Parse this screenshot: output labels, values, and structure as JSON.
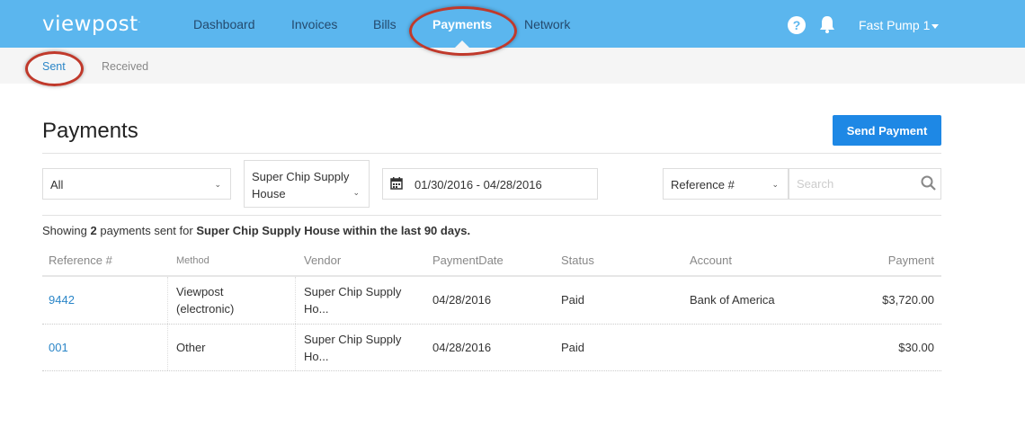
{
  "brand": {
    "logo": "viewpost",
    "mark": "."
  },
  "nav": {
    "items": [
      {
        "label": "Dashboard"
      },
      {
        "label": "Invoices"
      },
      {
        "label": "Bills"
      },
      {
        "label": "Payments",
        "active": true
      },
      {
        "label": "Network"
      }
    ],
    "user": "Fast Pump 1",
    "help_glyph": "?"
  },
  "subnav": {
    "items": [
      {
        "label": "Sent",
        "active": true
      },
      {
        "label": "Received"
      }
    ]
  },
  "page": {
    "title": "Payments",
    "send_button": "Send Payment"
  },
  "filters": {
    "status": "All",
    "vendor_line1": "Super Chip Supply",
    "vendor_line2": "House",
    "date_range": "01/30/2016 - 04/28/2016",
    "search_field": "Reference #",
    "search_placeholder": "Search"
  },
  "summary": {
    "prefix": "Showing",
    "count": "2",
    "middle": "payments sent for",
    "vendor": "Super Chip Supply House within the last 90 days."
  },
  "table": {
    "columns": [
      "Reference #",
      "Method",
      "Vendor",
      "PaymentDate",
      "Status",
      "Account",
      "Payment"
    ],
    "rows": [
      {
        "reference": "9442",
        "method_l1": "Viewpost",
        "method_l2": "(electronic)",
        "vendor_l1": "Super Chip Supply",
        "vendor_l2": "Ho...",
        "date": "04/28/2016",
        "status": "Paid",
        "account": "Bank of America",
        "payment": "$3,720.00"
      },
      {
        "reference": "001",
        "method_l1": "Other",
        "method_l2": "",
        "vendor_l1": "Super Chip Supply",
        "vendor_l2": "Ho...",
        "date": "04/28/2016",
        "status": "Paid",
        "account": "",
        "payment": "$30.00"
      }
    ]
  },
  "colors": {
    "nav_bg": "#5bb6ee",
    "accent": "#1e88e5",
    "link": "#2b86c8",
    "annotation": "#c0392b"
  }
}
